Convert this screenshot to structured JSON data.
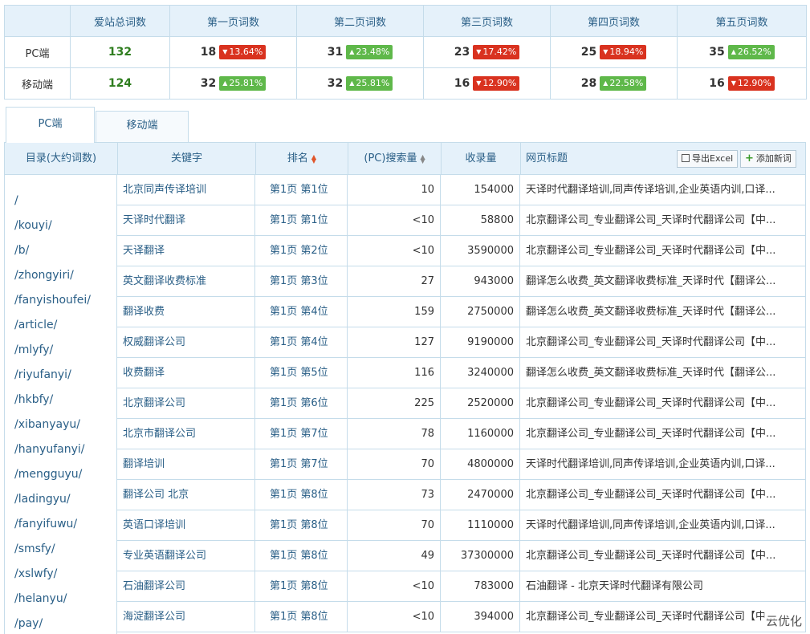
{
  "summary": {
    "headers": [
      "",
      "爱站总词数",
      "第一页词数",
      "第二页词数",
      "第三页词数",
      "第四页词数",
      "第五页词数"
    ],
    "rows": [
      {
        "label": "PC端",
        "total": "132",
        "pages": [
          {
            "count": "18",
            "change": "13.64%",
            "dir": "down"
          },
          {
            "count": "31",
            "change": "23.48%",
            "dir": "up"
          },
          {
            "count": "23",
            "change": "17.42%",
            "dir": "down"
          },
          {
            "count": "25",
            "change": "18.94%",
            "dir": "down"
          },
          {
            "count": "35",
            "change": "26.52%",
            "dir": "up"
          }
        ]
      },
      {
        "label": "移动端",
        "total": "124",
        "pages": [
          {
            "count": "32",
            "change": "25.81%",
            "dir": "up"
          },
          {
            "count": "32",
            "change": "25.81%",
            "dir": "up"
          },
          {
            "count": "16",
            "change": "12.90%",
            "dir": "down"
          },
          {
            "count": "28",
            "change": "22.58%",
            "dir": "up"
          },
          {
            "count": "16",
            "change": "12.90%",
            "dir": "down"
          }
        ]
      }
    ]
  },
  "tabs": [
    {
      "label": "PC端",
      "active": true
    },
    {
      "label": "移动端",
      "active": false
    }
  ],
  "table": {
    "headers": {
      "dir": "目录(大约词数)",
      "keyword": "关键字",
      "rank": "排名",
      "volume": "(PC)搜索量",
      "index": "收录量",
      "title": "网页标题"
    },
    "buttons": {
      "export": "导出Excel",
      "add": "添加新词"
    },
    "directories": [
      "/",
      "/kouyi/",
      "/b/",
      "/zhongyiri/",
      "/fanyishoufei/",
      "/article/",
      "/mlyfy/",
      "/riyufanyi/",
      "/hkbfy/",
      "/xibanyayu/",
      "/hanyufanyi/",
      "/mengguyu/",
      "/ladingyu/",
      "/fanyifuwu/",
      "/smsfy/",
      "/xslwfy/",
      "/helanyu/",
      "/pay/"
    ],
    "rows": [
      {
        "keyword": "北京同声传译培训",
        "rank": "第1页 第1位",
        "volume": "10",
        "index": "154000",
        "title": "天译时代翻译培训,同声传译培训,企业英语内训,口译..."
      },
      {
        "keyword": "天译时代翻译",
        "rank": "第1页 第1位",
        "volume": "<10",
        "index": "58800",
        "title": "北京翻译公司_专业翻译公司_天译时代翻译公司【中..."
      },
      {
        "keyword": "天译翻译",
        "rank": "第1页 第2位",
        "volume": "<10",
        "index": "3590000",
        "title": "北京翻译公司_专业翻译公司_天译时代翻译公司【中..."
      },
      {
        "keyword": "英文翻译收费标准",
        "rank": "第1页 第3位",
        "volume": "27",
        "index": "943000",
        "title": "翻译怎么收费_英文翻译收费标准_天译时代【翻译公..."
      },
      {
        "keyword": "翻译收费",
        "rank": "第1页 第4位",
        "volume": "159",
        "index": "2750000",
        "title": "翻译怎么收费_英文翻译收费标准_天译时代【翻译公..."
      },
      {
        "keyword": "权威翻译公司",
        "rank": "第1页 第4位",
        "volume": "127",
        "index": "9190000",
        "title": "北京翻译公司_专业翻译公司_天译时代翻译公司【中..."
      },
      {
        "keyword": "收费翻译",
        "rank": "第1页 第5位",
        "volume": "116",
        "index": "3240000",
        "title": "翻译怎么收费_英文翻译收费标准_天译时代【翻译公..."
      },
      {
        "keyword": "北京翻译公司",
        "rank": "第1页 第6位",
        "volume": "225",
        "index": "2520000",
        "title": "北京翻译公司_专业翻译公司_天译时代翻译公司【中..."
      },
      {
        "keyword": "北京市翻译公司",
        "rank": "第1页 第7位",
        "volume": "78",
        "index": "1160000",
        "title": "北京翻译公司_专业翻译公司_天译时代翻译公司【中..."
      },
      {
        "keyword": "翻译培训",
        "rank": "第1页 第7位",
        "volume": "70",
        "index": "4800000",
        "title": "天译时代翻译培训,同声传译培训,企业英语内训,口译..."
      },
      {
        "keyword": "翻译公司 北京",
        "rank": "第1页 第8位",
        "volume": "73",
        "index": "2470000",
        "title": "北京翻译公司_专业翻译公司_天译时代翻译公司【中..."
      },
      {
        "keyword": "英语口译培训",
        "rank": "第1页 第8位",
        "volume": "70",
        "index": "1110000",
        "title": "天译时代翻译培训,同声传译培训,企业英语内训,口译..."
      },
      {
        "keyword": "专业英语翻译公司",
        "rank": "第1页 第8位",
        "volume": "49",
        "index": "37300000",
        "title": "北京翻译公司_专业翻译公司_天译时代翻译公司【中..."
      },
      {
        "keyword": "石油翻译公司",
        "rank": "第1页 第8位",
        "volume": "<10",
        "index": "783000",
        "title": "石油翻译 - 北京天译时代翻译有限公司"
      },
      {
        "keyword": "海淀翻译公司",
        "rank": "第1页 第8位",
        "volume": "<10",
        "index": "394000",
        "title": "北京翻译公司_专业翻译公司_天译时代翻译公司【中..."
      }
    ]
  },
  "watermark": "云优化",
  "colors": {
    "accent": "#2a5f87",
    "border": "#c5dcea",
    "header_bg": "#e5f1fa",
    "up": "#5fb84a",
    "down": "#d9321f",
    "total": "#2e7d1e"
  }
}
